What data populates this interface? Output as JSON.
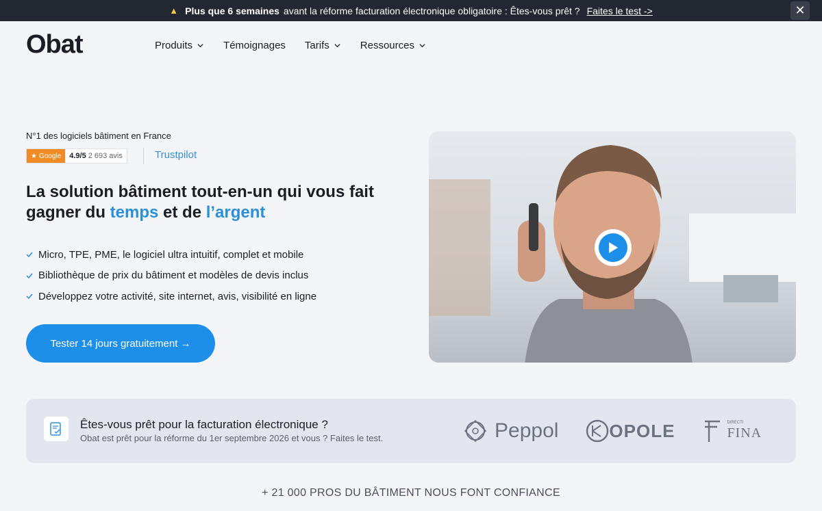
{
  "announcement": {
    "bold": "Plus que 6 semaines",
    "text": "avant la réforme facturation électronique obligatoire : Êtes-vous prêt ?",
    "link": "Faites le test ->",
    "close_icon": "close-icon"
  },
  "header": {
    "logo": "Obat",
    "nav": [
      {
        "label": "Produits",
        "dropdown": true
      },
      {
        "label": "Témoignages",
        "dropdown": false
      },
      {
        "label": "Tarifs",
        "dropdown": true
      },
      {
        "label": "Ressources",
        "dropdown": true
      }
    ]
  },
  "hero": {
    "kicker": "N°1 des logiciels bâtiment en France",
    "google_badge": "Google",
    "rating": "4.9/5",
    "reviews": "2 693 avis",
    "trustpilot": "Trustpilot",
    "headline_part1": "La solution bâtiment tout-en-un qui vous fait gagner du ",
    "headline_hl1": "temps",
    "headline_part2": " et de ",
    "headline_hl2": "l’argent",
    "bullets": [
      "Micro, TPE, PME, le logiciel ultra intuitif, complet et mobile",
      "Bibliothèque de prix du bâtiment et modèles de devis inclus",
      "Développez votre activité, site internet, avis, visibilité en ligne"
    ],
    "cta": "Tester 14 jours gratuitement →",
    "accent_color": "#1e8fe8"
  },
  "banner": {
    "title": "Êtes-vous prêt pour la facturation électronique ?",
    "subtitle": "Obat est prêt pour la réforme du 1er septembre 2026 et vous ? Faites le test.",
    "logos": {
      "peppol": "Peppol",
      "chorus": "OPOLE",
      "dgfip_small": "DIRECTI",
      "dgfip_big": "FINA"
    }
  },
  "trust_line": "+ 21 000 PROS DU BÂTIMENT NOUS FONT CONFIANCE"
}
